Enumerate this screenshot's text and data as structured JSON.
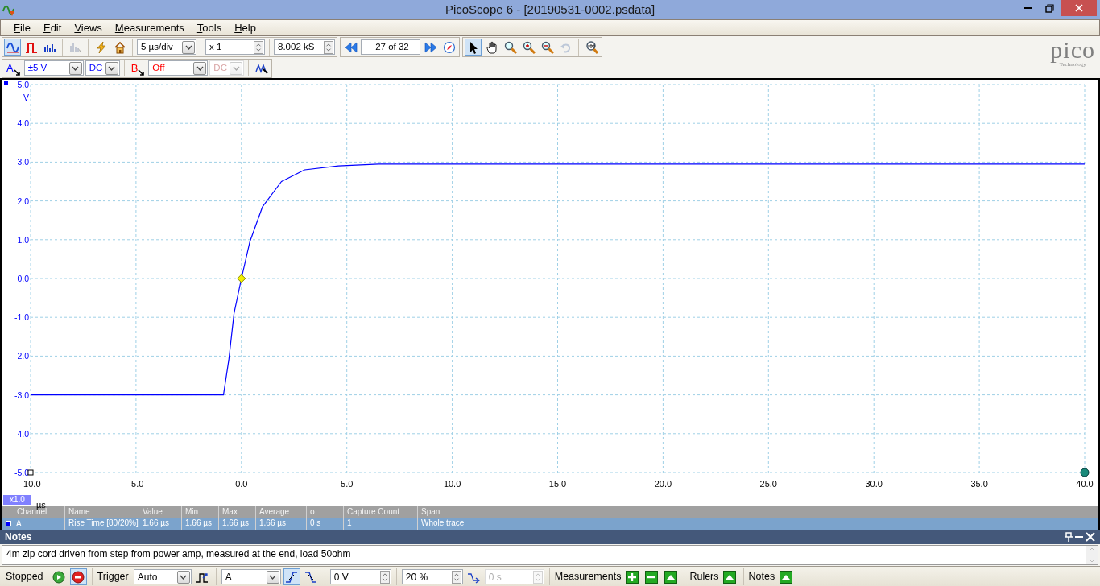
{
  "window": {
    "title": "PicoScope 6 - [20190531-0002.psdata]"
  },
  "menu": [
    "File",
    "Edit",
    "Views",
    "Measurements",
    "Tools",
    "Help"
  ],
  "toolbar": {
    "view_modes": [
      {
        "kind": "scope",
        "selected": true,
        "disabled": false
      },
      {
        "kind": "persistence",
        "selected": false,
        "disabled": false
      },
      {
        "kind": "spectrum",
        "selected": false,
        "disabled": false
      },
      {
        "kind": "xy",
        "selected": false,
        "disabled": true
      }
    ],
    "actions": [
      {
        "kind": "auto-setup"
      },
      {
        "kind": "home"
      }
    ],
    "timebase": "5 µs/div",
    "zoom": "x 1",
    "samples": "8.002 kS",
    "buffer": "27 of 32",
    "tools": [
      {
        "kind": "pointer",
        "selected": true,
        "disabled": false
      },
      {
        "kind": "hand",
        "selected": false,
        "disabled": false
      },
      {
        "kind": "zoom-fit",
        "selected": false,
        "disabled": false
      },
      {
        "kind": "zoom-in",
        "selected": false,
        "disabled": false
      },
      {
        "kind": "zoom-out",
        "selected": false,
        "disabled": false
      },
      {
        "kind": "undo",
        "selected": false,
        "disabled": true
      },
      {
        "kind": "zoom-full",
        "selected": false,
        "disabled": false
      }
    ]
  },
  "logo": {
    "name": "pico",
    "tagline": "Technology"
  },
  "channels": [
    {
      "letter": "A",
      "range": "±5 V",
      "coupling": "DC",
      "enabled": true,
      "color": "#0000ff"
    },
    {
      "letter": "B",
      "range": "Off",
      "coupling": "DC",
      "enabled": false,
      "color": "#ff0000"
    }
  ],
  "scope": {
    "y_unit": "V",
    "x_unit": "µs",
    "zoom_badge": "x1.0",
    "chart_data": {
      "type": "line",
      "grid": true,
      "xlim": [
        -10,
        40
      ],
      "ylim": [
        -5,
        5
      ],
      "xticks": [
        {
          "value": -10,
          "label": "-10.0"
        },
        {
          "value": -5,
          "label": "-5.0"
        },
        {
          "value": 0,
          "label": "0.0"
        },
        {
          "value": 5,
          "label": "5.0"
        },
        {
          "value": 10,
          "label": "10.0"
        },
        {
          "value": 15,
          "label": "15.0"
        },
        {
          "value": 20,
          "label": "20.0"
        },
        {
          "value": 25,
          "label": "25.0"
        },
        {
          "value": 30,
          "label": "30.0"
        },
        {
          "value": 35,
          "label": "35.0"
        },
        {
          "value": 40,
          "label": "40.0"
        }
      ],
      "yticks": [
        {
          "value": 5,
          "label": "5.0"
        },
        {
          "value": 4,
          "label": "4.0"
        },
        {
          "value": 3,
          "label": "3.0"
        },
        {
          "value": 2,
          "label": "2.0"
        },
        {
          "value": 1,
          "label": "1.0"
        },
        {
          "value": 0,
          "label": "0.0"
        },
        {
          "value": -1,
          "label": "-1.0"
        },
        {
          "value": -2,
          "label": "-2.0"
        },
        {
          "value": -3,
          "label": "-3.0"
        },
        {
          "value": -4,
          "label": "-4.0"
        },
        {
          "value": -5,
          "label": "-5.0"
        }
      ],
      "x": [
        -10,
        -0.85,
        -0.6,
        -0.35,
        0,
        0.4,
        1,
        1.9,
        3,
        4.6,
        6.5,
        40
      ],
      "series": [
        {
          "color": "#0000ff",
          "values": [
            -3,
            -3,
            -2.1,
            -0.9,
            0,
            0.95,
            1.85,
            2.5,
            2.8,
            2.9,
            2.95,
            2.95
          ]
        }
      ]
    }
  },
  "measurements": {
    "columns": [
      "Channel",
      "Name",
      "Value",
      "Min",
      "Max",
      "Average",
      "σ",
      "Capture Count",
      "Span"
    ],
    "rows": [
      {
        "selected": true,
        "color": "#0000ff",
        "cells": [
          "A",
          "Rise Time  [80/20%]",
          "1.66 µs",
          "1.66 µs",
          "1.66 µs",
          "1.66 µs",
          "0 s",
          "1",
          "Whole trace"
        ]
      }
    ]
  },
  "notes": {
    "title": "Notes",
    "text": "4m zip cord driven from step from power amp, measured at the end, load 50ohm"
  },
  "status_bar": {
    "state": "Stopped",
    "trigger_label": "Trigger",
    "trigger_mode": "Auto",
    "trigger_channel": "A",
    "edges": [
      {
        "kind": "rising",
        "selected": true
      },
      {
        "kind": "falling",
        "selected": false
      }
    ],
    "threshold": "0 V",
    "pre_trigger": "20 %",
    "delay": {
      "value": "0 s",
      "disabled": true
    },
    "panels": [
      {
        "label": "Measurements",
        "kind": "editable"
      },
      {
        "label": "Rulers",
        "kind": "toggle"
      },
      {
        "label": "Notes",
        "kind": "toggle"
      }
    ]
  }
}
